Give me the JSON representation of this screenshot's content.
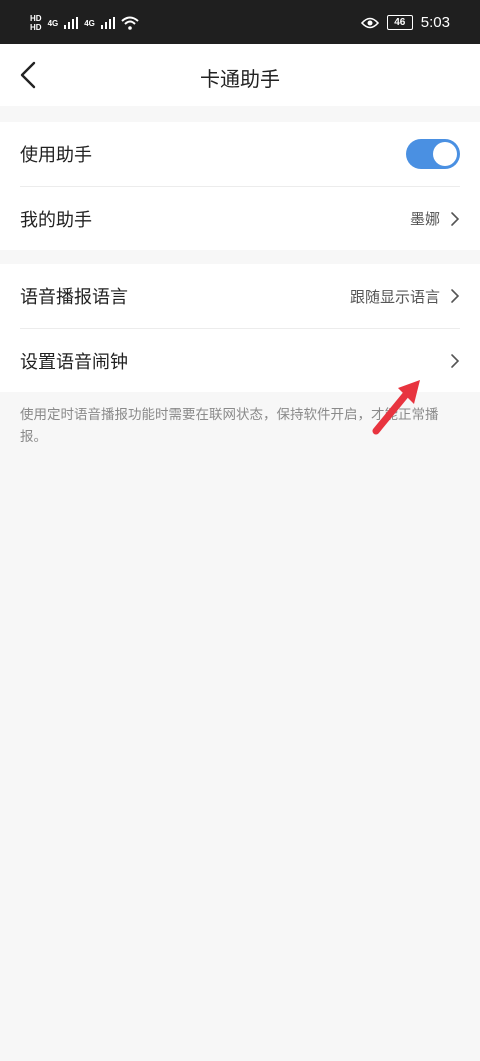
{
  "status_bar": {
    "hd1": "HD",
    "hd2": "HD",
    "net1": "4G",
    "net2": "4G",
    "battery": "46",
    "time": "5:03",
    "icons": [
      "signal-icon",
      "wifi-icon",
      "eye-icon",
      "battery-icon"
    ]
  },
  "header": {
    "title": "卡通助手",
    "back_icon": "back-arrow-icon"
  },
  "group1": {
    "use_assistant": {
      "label": "使用助手",
      "toggle_on": true
    },
    "my_assistant": {
      "label": "我的助手",
      "value": "墨娜"
    }
  },
  "group2": {
    "voice_language": {
      "label": "语音播报语言",
      "value": "跟随显示语言"
    },
    "voice_alarm": {
      "label": "设置语音闹钟"
    }
  },
  "note": "使用定时语音播报功能时需要在联网状态，保持软件开启，才能正常播报。",
  "colors": {
    "accent": "#4a90e2",
    "annotation_arrow": "#e8343f"
  }
}
